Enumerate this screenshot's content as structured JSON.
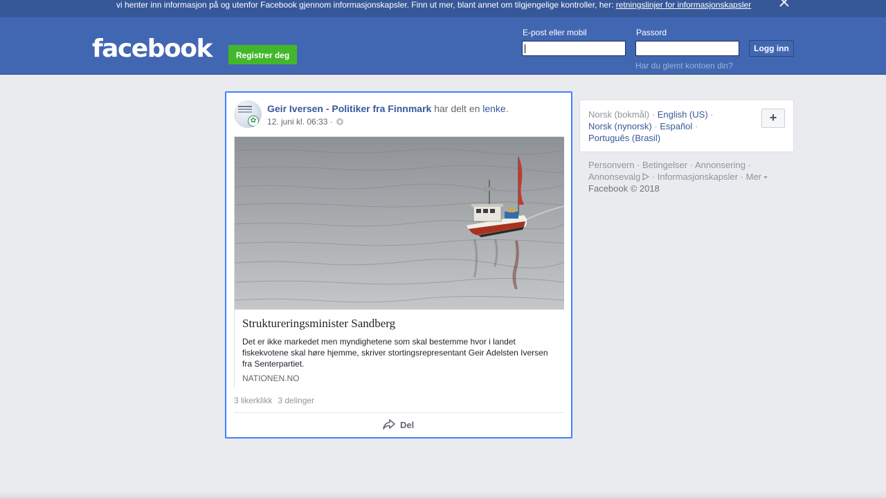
{
  "cookie_banner": {
    "text": "vi henter inn informasjon på og utenfor Facebook gjennom informasjonskapsler. Finn ut mer, blant annet om tilgjengelige kontroller, her: ",
    "link_text": "retningslinjer for informasjonskapsler",
    "close_icon": "close-icon"
  },
  "header": {
    "logo": "facebook",
    "register_label": "Registrer deg",
    "email_label": "E-post eller mobil",
    "email_value": "",
    "password_label": "Passord",
    "password_value": "",
    "login_label": "Logg inn",
    "forgot_label": "Har du glemt kontoen din?"
  },
  "post": {
    "author": "Geir Iversen - Politiker fra Finnmark",
    "verb": " har delt en ",
    "link_word": "lenke",
    "period": ".",
    "timestamp": "12. juni kl. 06:33 · ",
    "audience_icon": "globe-icon",
    "link": {
      "title": "Struktureringsminister Sandberg",
      "description": "Det er ikke markedet men myndighetene som skal bestemme hvor i landet fiskekvotene skal høre hjemme, skriver stortingsrepresentant Geir Adelsten Iversen fra Senterpartiet.",
      "domain": "NATIONEN.NO"
    },
    "likes": "3 likerklikk",
    "shares": "3 delinger",
    "share_label": "Del",
    "share_icon": "share-arrow-icon"
  },
  "languages": {
    "current": "Norsk (bokmål)",
    "sep": " · ",
    "english": "English (US)",
    "nynorsk": "Norsk (nynorsk)",
    "spanish": "Español",
    "portuguese": "Português (Brasil)",
    "add_label": "+"
  },
  "footer": {
    "privacy": "Personvern",
    "terms": "Betingelser",
    "advertising": "Annonsering",
    "adchoices": "Annonsevalg",
    "cookies": "Informasjonskapsler",
    "more": "Mer",
    "copyright": "Facebook © 2018"
  },
  "colors": {
    "brand_blue": "#4267b2",
    "banner_blue": "#365899",
    "register_green": "#42b72a",
    "focus_border": "#4080ff"
  }
}
